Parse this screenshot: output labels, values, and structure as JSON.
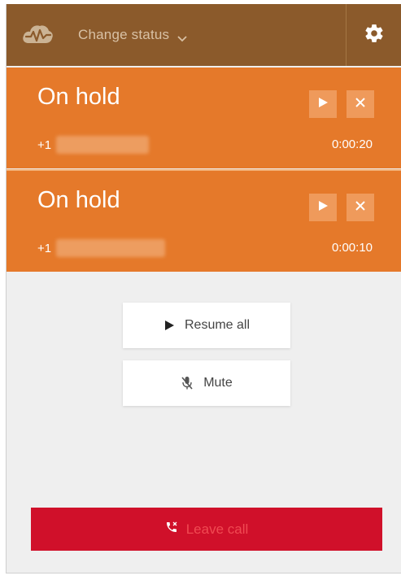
{
  "header": {
    "status_label": "Change status",
    "icons": {
      "logo": "cloud-wave-logo",
      "dropdown": "chevron-down-icon",
      "settings": "gear-icon"
    }
  },
  "calls": [
    {
      "title": "On hold",
      "number_prefix": "+1",
      "timer": "0:00:20"
    },
    {
      "title": "On hold",
      "number_prefix": "+1",
      "timer": "0:00:10"
    }
  ],
  "actions": {
    "resume_all_label": "Resume all",
    "mute_label": "Mute",
    "leave_call_label": "Leave call"
  },
  "colors": {
    "header_bg": "#8b5a2b",
    "call_bg": "#e5792a",
    "call_button_bg": "#ef9a5b",
    "panel_bg": "#efefef",
    "leave_bg": "#d0102a",
    "leave_text": "#f04a52"
  }
}
